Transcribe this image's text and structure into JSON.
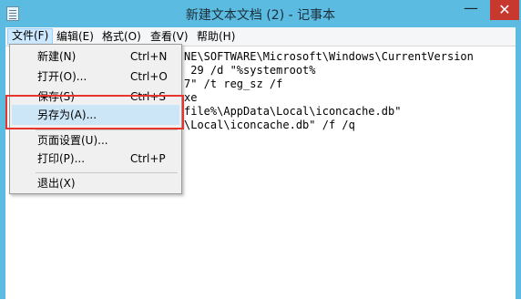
{
  "window": {
    "title": "新建文本文档 (2) - 记事本",
    "minimize_glyph": "—",
    "close_glyph": "✕"
  },
  "menubar": {
    "items": [
      {
        "label": "文件(F)"
      },
      {
        "label": "编辑(E)"
      },
      {
        "label": "格式(O)"
      },
      {
        "label": "查看(V)"
      },
      {
        "label": "帮助(H)"
      }
    ]
  },
  "editor": {
    "lines": [
      "NE\\SOFTWARE\\Microsoft\\Windows\\CurrentVersion",
      " 29 /d \"%systemroot%",
      "7\" /t reg_sz /f",
      "xe",
      "file%\\AppData\\Local\\iconcache.db\"",
      "\\Local\\iconcache.db\" /f /q"
    ]
  },
  "file_menu": {
    "items": [
      {
        "label": "新建(N)",
        "shortcut": "Ctrl+N"
      },
      {
        "label": "打开(O)...",
        "shortcut": "Ctrl+O"
      },
      {
        "label": "保存(S)",
        "shortcut": "Ctrl+S"
      },
      {
        "label": "另存为(A)...",
        "shortcut": ""
      },
      {
        "label": "页面设置(U)...",
        "shortcut": ""
      },
      {
        "label": "打印(P)...",
        "shortcut": "Ctrl+P"
      },
      {
        "label": "退出(X)",
        "shortcut": ""
      }
    ]
  }
}
